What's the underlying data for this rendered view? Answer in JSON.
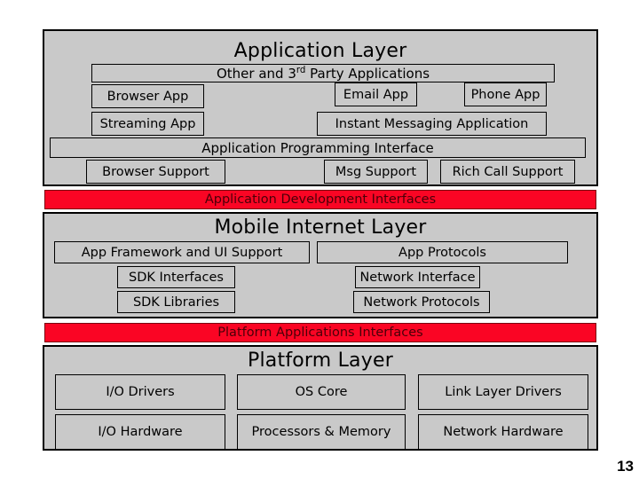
{
  "slide": {
    "page_number": "13",
    "background_color": "#ffffff",
    "panel_color": "#c9c9c9",
    "border_color": "#000000",
    "accent_color": "#fa0524",
    "accent_text_color": "#4a0008"
  },
  "layers": [
    {
      "id": "application-layer",
      "title": "Application Layer",
      "boxes": [
        {
          "id": "other-3rd-party-applications",
          "label_prefix": "Other and 3",
          "label_sup": "rd",
          "label_suffix": " Party Applications"
        },
        {
          "id": "browser-app",
          "label": "Browser App"
        },
        {
          "id": "email-app",
          "label": "Email App"
        },
        {
          "id": "phone-app",
          "label": "Phone App"
        },
        {
          "id": "streaming-app",
          "label": "Streaming App"
        },
        {
          "id": "instant-messaging-application",
          "label": "Instant Messaging Application"
        },
        {
          "id": "application-programming-interface",
          "label": "Application Programming Interface"
        },
        {
          "id": "browser-support",
          "label": "Browser Support"
        },
        {
          "id": "msg-support",
          "label": "Msg Support"
        },
        {
          "id": "rich-call-support",
          "label": "Rich Call Support"
        }
      ]
    },
    {
      "id": "mobile-internet-layer",
      "title": "Mobile Internet Layer",
      "boxes": [
        {
          "id": "app-framework-and-ui-support",
          "label": "App Framework and UI Support"
        },
        {
          "id": "app-protocols",
          "label": "App Protocols"
        },
        {
          "id": "sdk-interfaces",
          "label": "SDK Interfaces"
        },
        {
          "id": "network-interface",
          "label": "Network Interface"
        },
        {
          "id": "sdk-libraries",
          "label": "SDK Libraries"
        },
        {
          "id": "network-protocols",
          "label": "Network Protocols"
        }
      ]
    },
    {
      "id": "platform-layer",
      "title": "Platform Layer",
      "boxes": [
        {
          "id": "io-drivers",
          "label": "I/O Drivers"
        },
        {
          "id": "os-core",
          "label": "OS Core"
        },
        {
          "id": "link-layer-drivers",
          "label": "Link Layer Drivers"
        },
        {
          "id": "io-hardware",
          "label": "I/O Hardware"
        },
        {
          "id": "processors-and-memory",
          "label": "Processors & Memory"
        },
        {
          "id": "network-hardware",
          "label": "Network Hardware"
        }
      ]
    }
  ],
  "interface_bars": [
    {
      "id": "application-development-interfaces",
      "label": "Application Development Interfaces"
    },
    {
      "id": "platform-applications-interfaces",
      "label": "Platform Applications Interfaces"
    }
  ]
}
